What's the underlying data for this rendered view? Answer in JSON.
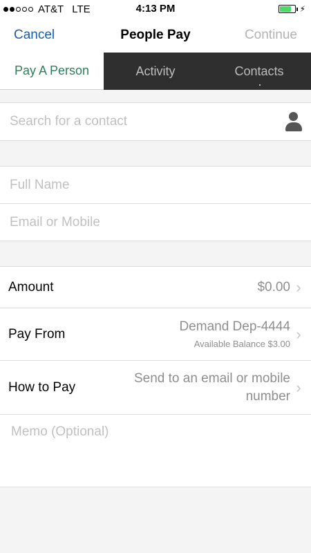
{
  "status": {
    "carrier": "AT&T",
    "network": "LTE",
    "time": "4:13 PM",
    "signal_bars_filled": 2,
    "signal_bars_total": 5,
    "battery_level": 0.8,
    "battery_color": "#4cd964",
    "charging_symbol": "⚡"
  },
  "nav": {
    "left": "Cancel",
    "title": "People Pay",
    "right": "Continue"
  },
  "tabs": [
    {
      "label": "Pay A Person",
      "active": true
    },
    {
      "label": "Activity",
      "active": false
    },
    {
      "label": "Contacts",
      "active": false
    }
  ],
  "search": {
    "placeholder": "Search for a contact",
    "icon": "person-icon"
  },
  "recipient": {
    "full_name_placeholder": "Full Name",
    "contact_placeholder": "Email or Mobile"
  },
  "payment": {
    "amount_label": "Amount",
    "amount_value": "$0.00",
    "pay_from_label": "Pay From",
    "pay_from_account": "Demand Dep-4444",
    "pay_from_balance": "Available Balance $3.00",
    "how_to_pay_label": "How to Pay",
    "how_to_pay_value": "Send to an email or mobile number",
    "memo_placeholder": "Memo (Optional)"
  },
  "colors": {
    "accent_blue": "#1a5ca8",
    "active_tab_green": "#2e7d5b",
    "dark_tab_bg": "#2f2f2f"
  }
}
